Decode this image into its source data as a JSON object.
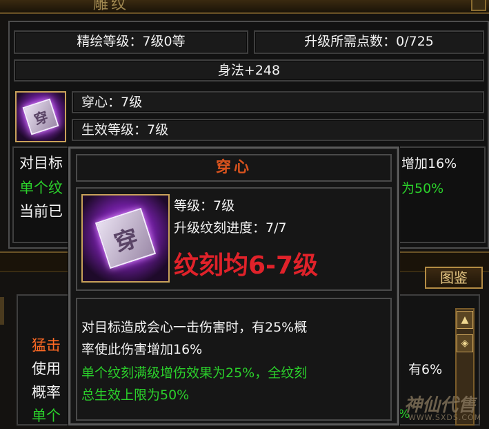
{
  "window": {
    "title": "雕纹"
  },
  "summary": {
    "level_text": "精绘等级：7级0等",
    "points_text": "升级所需点数：0/725",
    "bonus_text": "身法+248"
  },
  "rune": {
    "name_text": "穿心：7级",
    "effect_level_text": "生效等级：7级",
    "glyph": "穿"
  },
  "bg_desc": {
    "line1_left": "对目标",
    "line1_right": "增加16%",
    "line2_left": "单个纹",
    "line2_right": "为50%",
    "line3_left": "当前已"
  },
  "lower": {
    "tujian_button": "图鉴",
    "rows": [
      {
        "left": "猛击",
        "right": "",
        "color": "orange"
      },
      {
        "left": "使用",
        "right": "有6%",
        "color": "white"
      },
      {
        "left": "概率",
        "right": "",
        "color": "white"
      },
      {
        "left": "单个",
        "right": "%",
        "color": "green"
      }
    ]
  },
  "tooltip": {
    "title": "穿心",
    "glyph": "穿",
    "level_text": "等级：7级",
    "progress_text": "升级纹刻进度：7/7",
    "highlight_text": "纹刻均6-7级",
    "desc_line1": "对目标造成会心一击伤害时，有25%概",
    "desc_line2": "率使此伤害增加16%",
    "desc_green1": "单个纹刻满级增伤效果为25%，全纹刻",
    "desc_green2": "总生效上限为50%"
  },
  "watermark": {
    "brand": "神仙代售",
    "url": "WWW.SXDS.COM"
  },
  "colors": {
    "gold": "#c9a25a",
    "green": "#2bd12b",
    "red": "#e0222a",
    "orange": "#ff6a24",
    "title": "#d9531e"
  },
  "icons": [
    "close-icon",
    "rune-icon",
    "scroll-up-icon",
    "scroll-settings-icon",
    "watermark-logo-icon"
  ]
}
